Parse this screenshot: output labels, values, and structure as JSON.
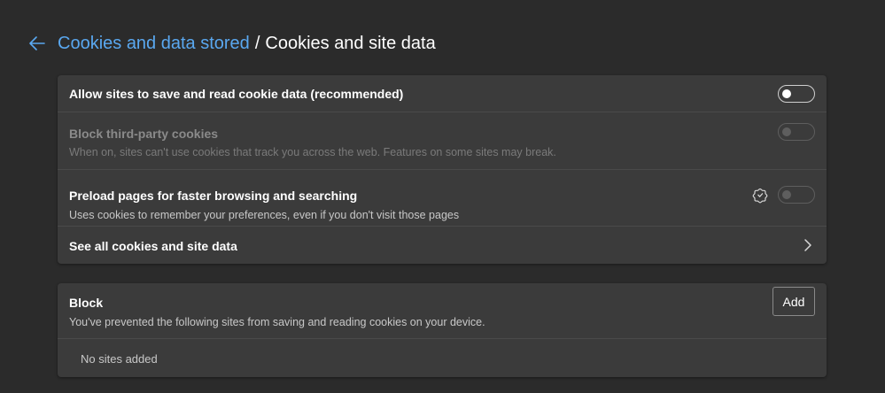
{
  "header": {
    "back_icon": "arrow-left-icon",
    "breadcrumb_link": "Cookies and data stored",
    "separator": "/",
    "current": "Cookies and site data"
  },
  "settings": [
    {
      "title": "Allow sites to save and read cookie data (recommended)",
      "toggle_on": false,
      "enabled": true
    },
    {
      "title": "Block third-party cookies",
      "description": "When on, sites can't use cookies that track you across the web. Features on some sites may break.",
      "toggle_on": false,
      "enabled": false
    },
    {
      "title": "Preload pages for faster browsing and searching",
      "description": "Uses cookies to remember your preferences, even if you don't visit those pages",
      "toggle_on": false,
      "enabled": false,
      "policy_icon": "managed-by-organization-icon"
    },
    {
      "title": "See all cookies and site data",
      "nav_icon": "chevron-right-icon"
    }
  ],
  "block": {
    "title": "Block",
    "description": "You've prevented the following sites from saving and reading cookies on your device.",
    "add_label": "Add",
    "empty_text": "No sites added"
  },
  "colors": {
    "background": "#2b2b2b",
    "card": "#3b3b3b",
    "link": "#5aa8f0"
  }
}
